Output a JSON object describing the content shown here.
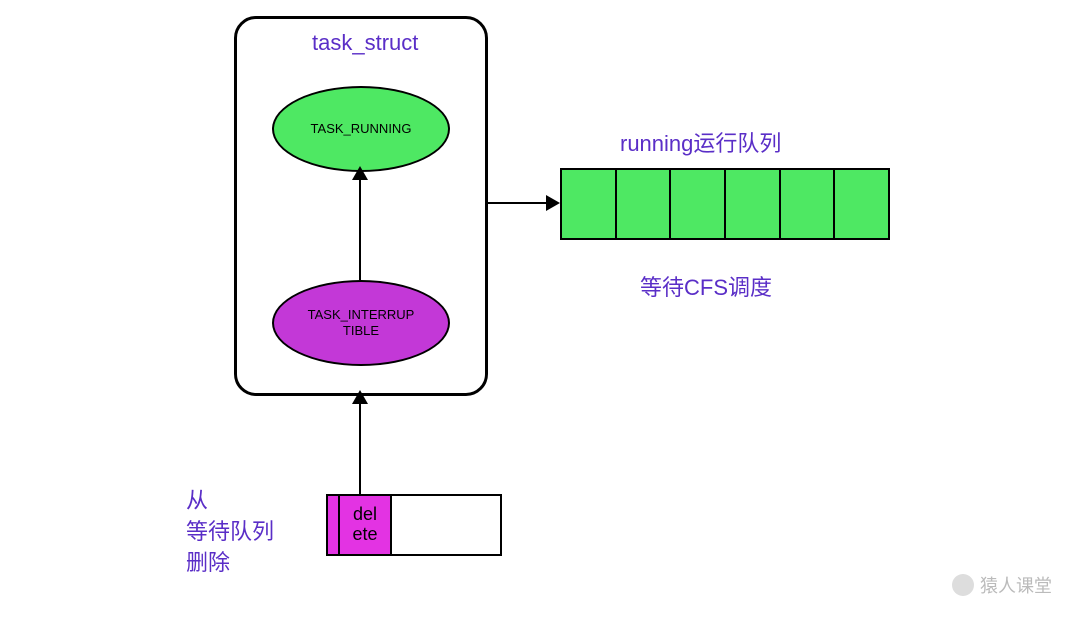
{
  "container": {
    "title": "task_struct"
  },
  "states": {
    "running": "TASK_RUNNING",
    "interruptible": "TASK_INTERRUP\nTIBLE"
  },
  "running_queue": {
    "title": "running运行队列",
    "caption": "等待CFS调度",
    "cell_count": 6
  },
  "delete_box": {
    "label": "del\nete"
  },
  "left_text": {
    "line1": "从",
    "line2": "等待队列",
    "line3": "删除"
  },
  "watermark": "猿人课堂"
}
